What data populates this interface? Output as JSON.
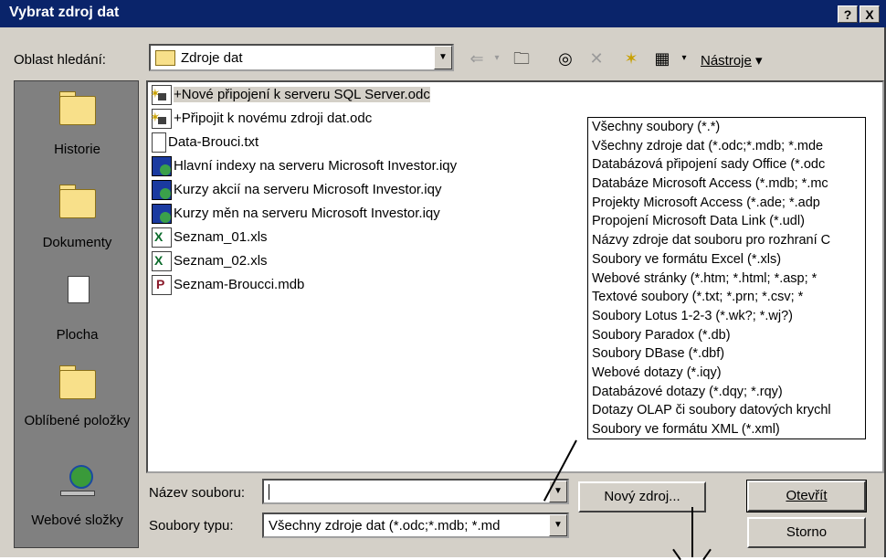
{
  "window": {
    "title": "Vybrat zdroj dat",
    "help_btn": "?",
    "close_btn": "X"
  },
  "lookin": {
    "label": "Oblast hledání:",
    "value": "Zdroje dat"
  },
  "toolbar": {
    "back_icon": "arrow-left",
    "up_icon": "folder-up",
    "search_web_icon": "globe-search",
    "delete_icon": "x",
    "new_folder_icon": "new-folder",
    "views_icon": "views",
    "tools_label": "Nástroje"
  },
  "places": [
    {
      "label": "Historie",
      "icon": "history-folder-icon"
    },
    {
      "label": "Dokumenty",
      "icon": "documents-folder-icon"
    },
    {
      "label": "Plocha",
      "icon": "desktop-icon"
    },
    {
      "label": "Oblíbené položky",
      "icon": "favorites-folder-icon"
    },
    {
      "label": "Webové složky",
      "icon": "web-folders-icon"
    }
  ],
  "files": [
    {
      "name": "+Nové připojení k serveru SQL Server.odc",
      "type": "odc",
      "selected": true
    },
    {
      "name": "+Připojit k novému zdroji dat.odc",
      "type": "odc"
    },
    {
      "name": "Data-Brouci.txt",
      "type": "txt"
    },
    {
      "name": "Hlavní indexy na serveru Microsoft Investor.iqy",
      "type": "iqy"
    },
    {
      "name": "Kurzy akcií na serveru Microsoft Investor.iqy",
      "type": "iqy"
    },
    {
      "name": "Kurzy měn na serveru Microsoft Investor.iqy",
      "type": "iqy"
    },
    {
      "name": "Seznam_01.xls",
      "type": "xls"
    },
    {
      "name": "Seznam_02.xls",
      "type": "xls"
    },
    {
      "name": "Seznam-Broucci.mdb",
      "type": "mdb"
    }
  ],
  "type_options": [
    "Všechny soubory (*.*)",
    "Všechny zdroje dat (*.odc;*.mdb; *.mde",
    "Databázová připojení sady Office (*.odc",
    "Databáze Microsoft Access (*.mdb; *.mc",
    "Projekty Microsoft Access (*.ade; *.adp",
    "Propojení Microsoft Data Link (*.udl)",
    "Názvy zdroje dat souboru pro rozhraní C",
    "Soubory ve formátu Excel (*.xls)",
    "Webové stránky (*.htm; *.html; *.asp; *",
    "Textové soubory (*.txt; *.prn; *.csv; *",
    "Soubory Lotus 1-2-3 (*.wk?; *.wj?)",
    "Soubory Paradox (*.db)",
    "Soubory DBase (*.dbf)",
    "Webové dotazy (*.iqy)",
    "Databázové dotazy (*.dqy; *.rqy)",
    "Dotazy OLAP či soubory datových krychl",
    "Soubory ve formátu XML (*.xml)"
  ],
  "filename": {
    "label": "Název souboru:",
    "value": ""
  },
  "filetype": {
    "label": "Soubory typu:",
    "value": "Všechny zdroje dat (*.odc;*.mdb; *.md"
  },
  "buttons": {
    "new_source": "Nový zdroj...",
    "open": "Otevřít",
    "cancel": "Storno"
  }
}
